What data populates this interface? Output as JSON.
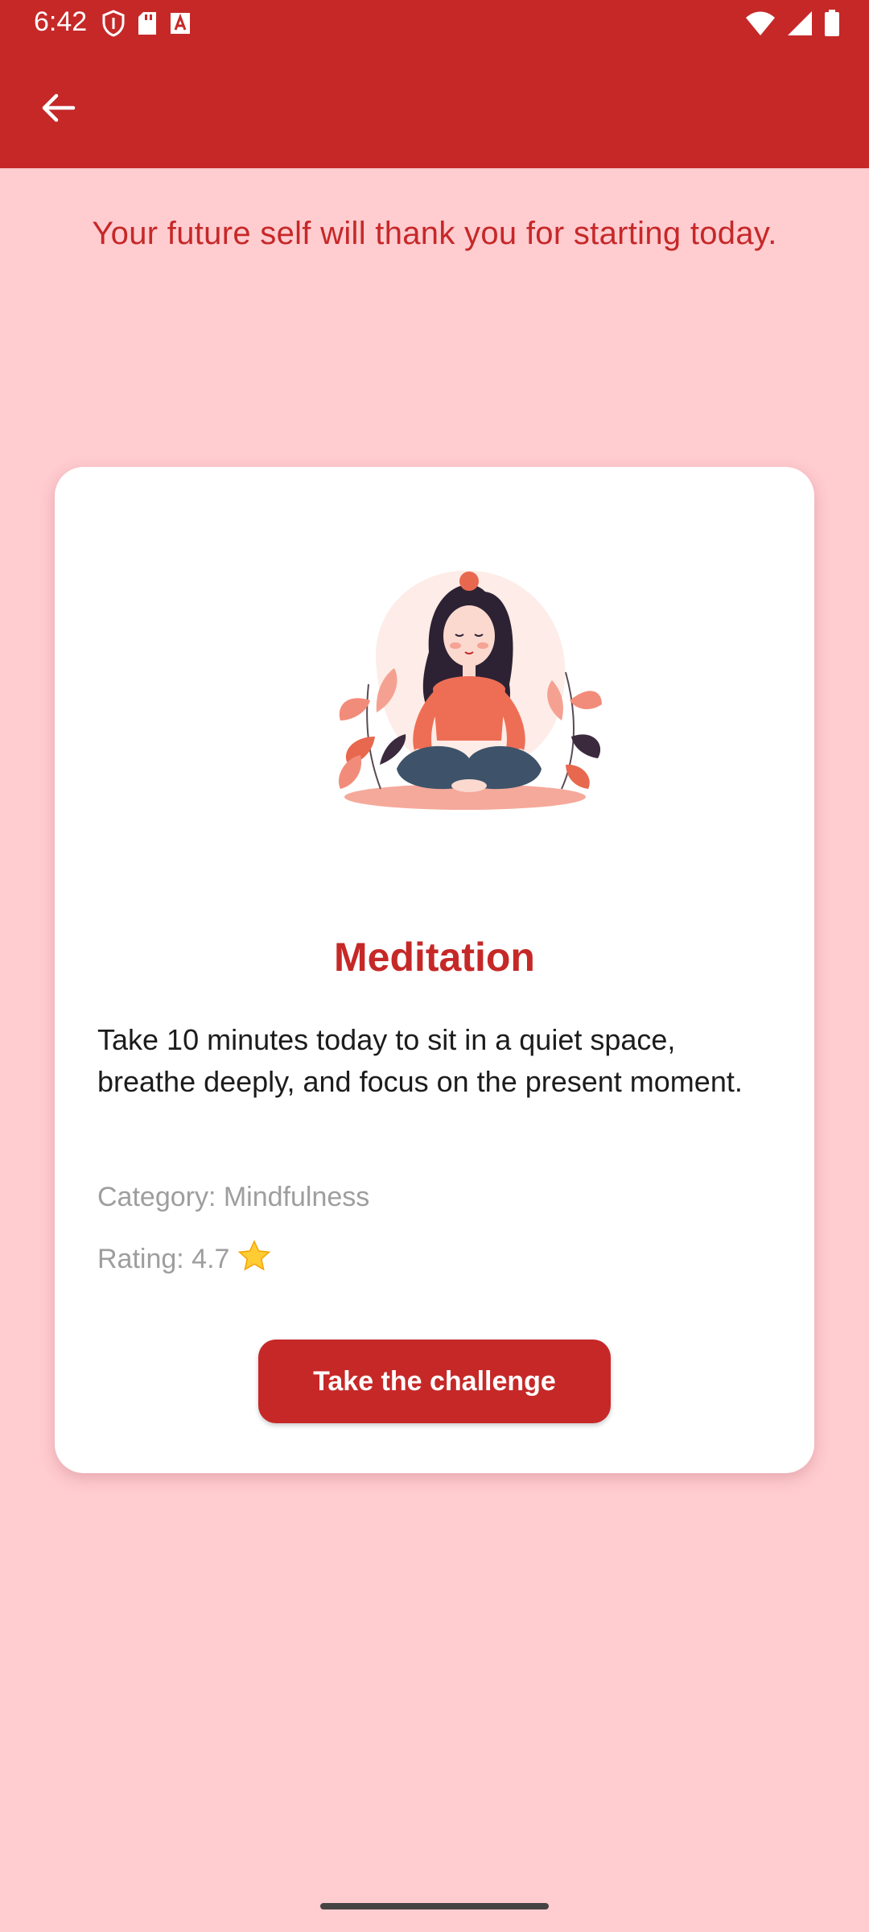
{
  "status_bar": {
    "time": "6:42",
    "left_icons": [
      "shield-icon",
      "sd-card-icon",
      "font-a-icon"
    ],
    "right_icons": [
      "wifi-icon",
      "signal-icon",
      "battery-icon"
    ]
  },
  "app_bar": {
    "back_icon": "arrow-left-icon",
    "color": "#C62828"
  },
  "motivation_text": "Your future self will thank you for starting today.",
  "card": {
    "image": "meditation-illustration",
    "title": "Meditation",
    "description": "Take 10 minutes today to sit in a quiet space, breathe deeply, and focus on the present moment.",
    "category": "Category: Mindfulness",
    "rating": "Rating: 4.7",
    "rating_icon": "star-icon",
    "button_label": "Take the challenge"
  },
  "colors": {
    "primary": "#C62828",
    "background": "#FFCCD0",
    "card": "#FFFFFF",
    "muted_text": "#9E9E9E"
  }
}
